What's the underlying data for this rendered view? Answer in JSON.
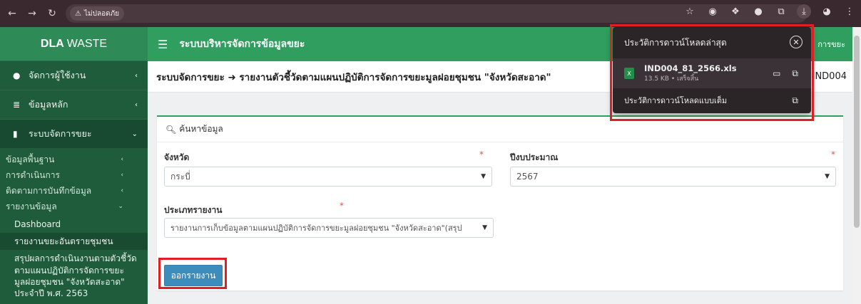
{
  "browser": {
    "security_label": "ไม่ปลอดภัย",
    "icons": [
      "back-icon",
      "forward-icon",
      "reload-icon",
      "warning-icon",
      "star-icon",
      "camera-icon",
      "extension-icon",
      "download-icon",
      "profile-icon",
      "more-icon"
    ]
  },
  "sidebar": {
    "brand_bold": "DLA",
    "brand_rest": "WASTE",
    "items": [
      {
        "label": "จัดการผู้ใช้งาน",
        "icon": "user-icon"
      },
      {
        "label": "ข้อมูลหลัก",
        "icon": "database-icon"
      },
      {
        "label": "ระบบจัดการขยะ",
        "icon": "trash-icon"
      }
    ],
    "subitems": [
      {
        "label": "ข้อมูลพื้นฐาน"
      },
      {
        "label": "การดำเนินการ"
      },
      {
        "label": "ติดตามการบันทึกข้อมูล"
      },
      {
        "label": "รายงานข้อมูล"
      }
    ],
    "report_items": [
      {
        "label": "Dashboard"
      },
      {
        "label": "รายงานขยะอันตรายชุมชน"
      },
      {
        "label": "สรุปผลการดำเนินงานตามตัวชี้วัดตามแผนปฏิบัติการจัดการขยะมูลฝอยชุมชน \"จังหวัดสะอาด\" ประจำปี พ.ศ. 2563"
      }
    ]
  },
  "header": {
    "title": "ระบบบริหารจัดการข้อมูลขยะ",
    "right_text": "การขยะ"
  },
  "title_row": {
    "text": "ระบบจัดการขยะ ➜ รายงานตัวชี้วัดตามแผนปฏิบัติการจัดการขยะมูลฝอยชุมชน \"จังหวัดสะอาด\"",
    "code": "IND004"
  },
  "search_card": {
    "heading": "ค้นหาข้อมูล",
    "province_label": "จังหวัด",
    "province_value": "กระบี่",
    "year_label": "ปีงบประมาณ",
    "year_value": "2567",
    "report_type_label": "ประเภทรายงาน",
    "report_type_value": "รายงานการเก็บข้อมูลตามแผนปฏิบัติการจัดการขยะมูลฝอยชุมชน \"จังหวัดสะอาด\"(สรุป",
    "required_mark": "*",
    "export_button": "ออกรายงาน"
  },
  "download_popup": {
    "title": "ประวัติการดาวน์โหลดล่าสุด",
    "file_name": "IND004_81_2566.xls",
    "file_meta": "13.5 KB • เสร็จสิ้น",
    "full_history": "ประวัติการดาวน์โหลดแบบเต็ม"
  },
  "colors": {
    "sidebar": "#1f5c3c",
    "header_green": "#2f9e5e",
    "button_blue": "#3c8dbc",
    "highlight_red": "#e01e26"
  }
}
